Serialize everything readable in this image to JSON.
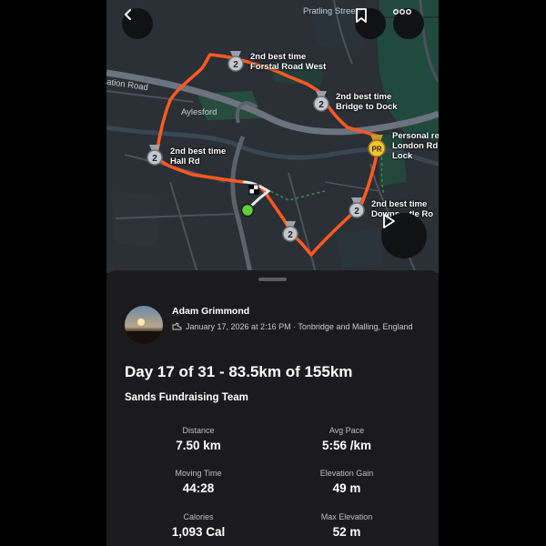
{
  "map": {
    "street_labels": [
      "Pratling Street",
      "ation Road",
      "Aylesford"
    ],
    "segments": [
      {
        "type": "2nd",
        "line1": "2nd best time",
        "line2": "Forstal Road West"
      },
      {
        "type": "2nd",
        "line1": "2nd best time",
        "line2": "Bridge to Dock"
      },
      {
        "type": "pr",
        "line1": "Personal re",
        "line2": "London Rd",
        "line3": "Lock"
      },
      {
        "type": "2nd",
        "line1": "2nd best time",
        "line2": "Hall Rd"
      },
      {
        "type": "2nd",
        "line1": "2nd best time",
        "line2": "Downs... tle Ro"
      }
    ],
    "medal_labels": {
      "second": "2",
      "pr": "PR"
    },
    "route_color": "#ff5a1f",
    "controls": [
      "back-icon",
      "bookmark-icon",
      "more-icon",
      "play-icon"
    ]
  },
  "activity": {
    "athlete": "Adam Grimmond",
    "date_location": "January 17, 2026 at 2:16 PM · Tonbridge and Malling, England",
    "title": "Day 17 of 31 - 83.5km of 155km",
    "club": "Sands Fundraising Team",
    "stats": [
      {
        "label": "Distance",
        "value": "7.50 km"
      },
      {
        "label": "Avg Pace",
        "value": "5:56 /km"
      },
      {
        "label": "Moving Time",
        "value": "44:28"
      },
      {
        "label": "Elevation Gain",
        "value": "49 m"
      },
      {
        "label": "Calories",
        "value": "1,093 Cal"
      },
      {
        "label": "Max Elevation",
        "value": "52 m"
      }
    ]
  }
}
